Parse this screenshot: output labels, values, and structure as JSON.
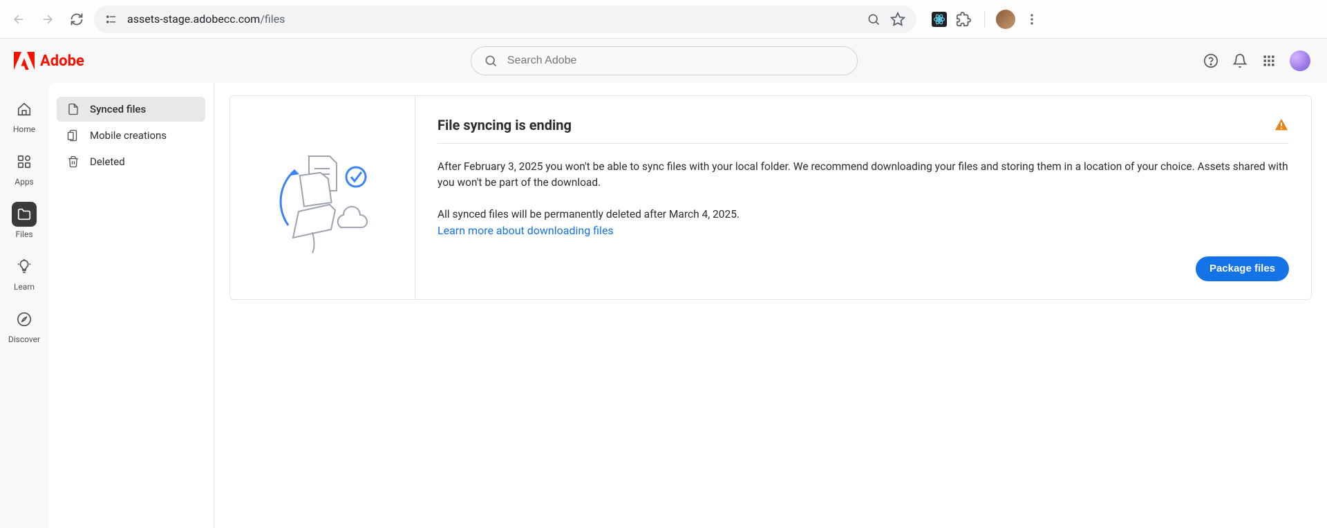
{
  "browser": {
    "url_host": "assets-stage.adobecc.com",
    "url_path": "/files"
  },
  "header": {
    "brand": "Adobe",
    "search_placeholder": "Search Adobe"
  },
  "rail": {
    "home": "Home",
    "apps": "Apps",
    "files": "Files",
    "learn": "Learn",
    "discover": "Discover"
  },
  "sidebar": {
    "items": [
      {
        "label": "Synced files"
      },
      {
        "label": "Mobile creations"
      },
      {
        "label": "Deleted"
      }
    ]
  },
  "banner": {
    "title": "File syncing is ending",
    "paragraph1": "After February 3, 2025 you won't be able to sync files with your local folder. We recommend downloading your files and storing them in a location of your choice. Assets shared with you won't be part of the download.",
    "paragraph2": "All synced files will be permanently deleted after March 4, 2025.",
    "link": "Learn more about downloading files",
    "button": "Package files"
  }
}
